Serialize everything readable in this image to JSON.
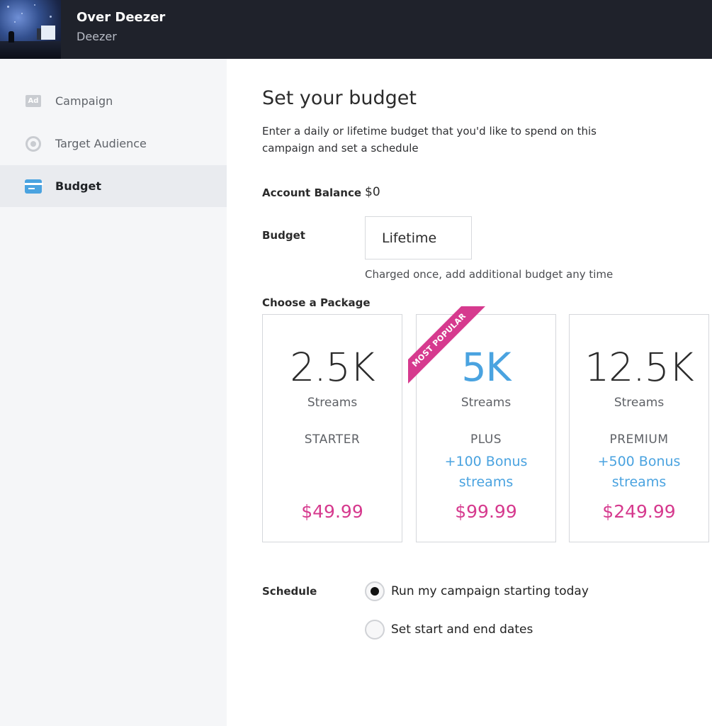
{
  "header": {
    "title": "Over Deezer",
    "subtitle": "Deezer"
  },
  "sidebar": {
    "items": [
      {
        "label": "Campaign",
        "icon": "ad-icon",
        "active": false
      },
      {
        "label": "Target Audience",
        "icon": "target-icon",
        "active": false
      },
      {
        "label": "Budget",
        "icon": "credit-card-icon",
        "active": true
      }
    ]
  },
  "main": {
    "heading": "Set your budget",
    "description": "Enter a daily or lifetime budget that you'd like to spend on this campaign and set a schedule",
    "account_balance": {
      "label": "Account Balance",
      "value": "$0"
    },
    "budget": {
      "label": "Budget",
      "value": "Lifetime",
      "hint": "Charged once, add additional budget any time"
    },
    "packages_label": "Choose a Package",
    "packages": [
      {
        "amount": "2.5K",
        "unit": "Streams",
        "tier": "STARTER",
        "bonus": "",
        "price": "$49.99"
      },
      {
        "amount": "5K",
        "unit": "Streams",
        "tier": "PLUS",
        "bonus": "+100 Bonus streams",
        "price": "$99.99",
        "ribbon": "MOST POPULAR"
      },
      {
        "amount": "12.5K",
        "unit": "Streams",
        "tier": "PREMIUM",
        "bonus": "+500 Bonus streams",
        "price": "$249.99"
      }
    ],
    "schedule": {
      "label": "Schedule",
      "options": [
        {
          "label": "Run my campaign starting today",
          "selected": true
        },
        {
          "label": "Set start and end dates",
          "selected": false
        }
      ]
    }
  },
  "colors": {
    "header_bg": "#1f222b",
    "accent_blue": "#4aa3e0",
    "price_pink": "#d63a8e",
    "sidebar_bg": "#f5f6f8"
  }
}
